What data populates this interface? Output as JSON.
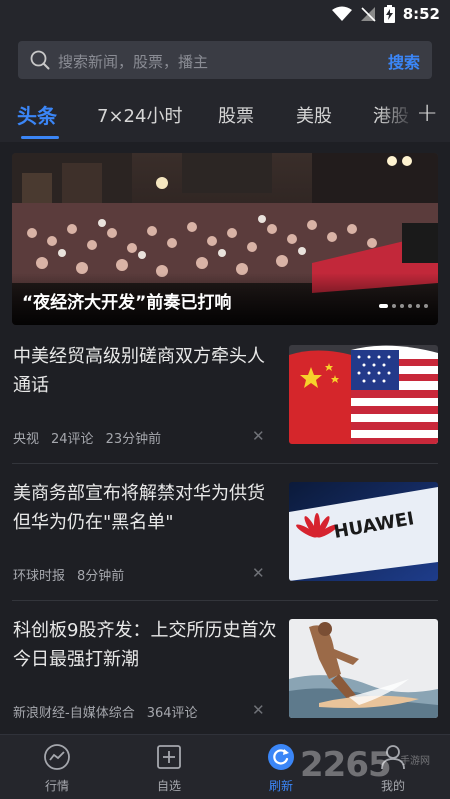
{
  "status": {
    "time": "8:52"
  },
  "search": {
    "placeholder": "搜索新闻，股票，播主",
    "button": "搜索"
  },
  "tabs": [
    {
      "label": "头条",
      "active": true
    },
    {
      "label": "7×24小时",
      "active": false
    },
    {
      "label": "股票",
      "active": false
    },
    {
      "label": "美股",
      "active": false
    },
    {
      "label": "港股",
      "active": false
    }
  ],
  "banner": {
    "caption": "“夜经济大开发”前奏已打响",
    "slide_count": 6,
    "active_slide": 1
  },
  "news": [
    {
      "title": "中美经贸高级别磋商双方牵头人通话",
      "source": "央视",
      "comments": "24评论",
      "time": "23分钟前",
      "thumb": "flags"
    },
    {
      "title": "美商务部宣布将解禁对华为供货 但华为仍在\"黑名单\"",
      "source": "环球时报",
      "comments": "",
      "time": "8分钟前",
      "thumb": "huawei",
      "thumb_text": "HUAWEI"
    },
    {
      "title": "科创板9股齐发：上交所历史首次 今日最强打新潮",
      "source": "新浪财经-自媒体综合",
      "comments": "364评论",
      "time": "",
      "thumb": "surf"
    }
  ],
  "bottom_nav": [
    {
      "label": "行情",
      "icon": "chart-circle-icon",
      "active": false
    },
    {
      "label": "自选",
      "icon": "plus-square-icon",
      "active": false
    },
    {
      "label": "刷新",
      "icon": "refresh-icon",
      "active": true
    },
    {
      "label": "我的",
      "icon": "user-icon",
      "active": false
    }
  ],
  "watermark": {
    "text": "2265",
    "sub": "手游网"
  },
  "colors": {
    "accent": "#3b86f7",
    "background": "#1e1f24",
    "bar": "#25262c"
  }
}
